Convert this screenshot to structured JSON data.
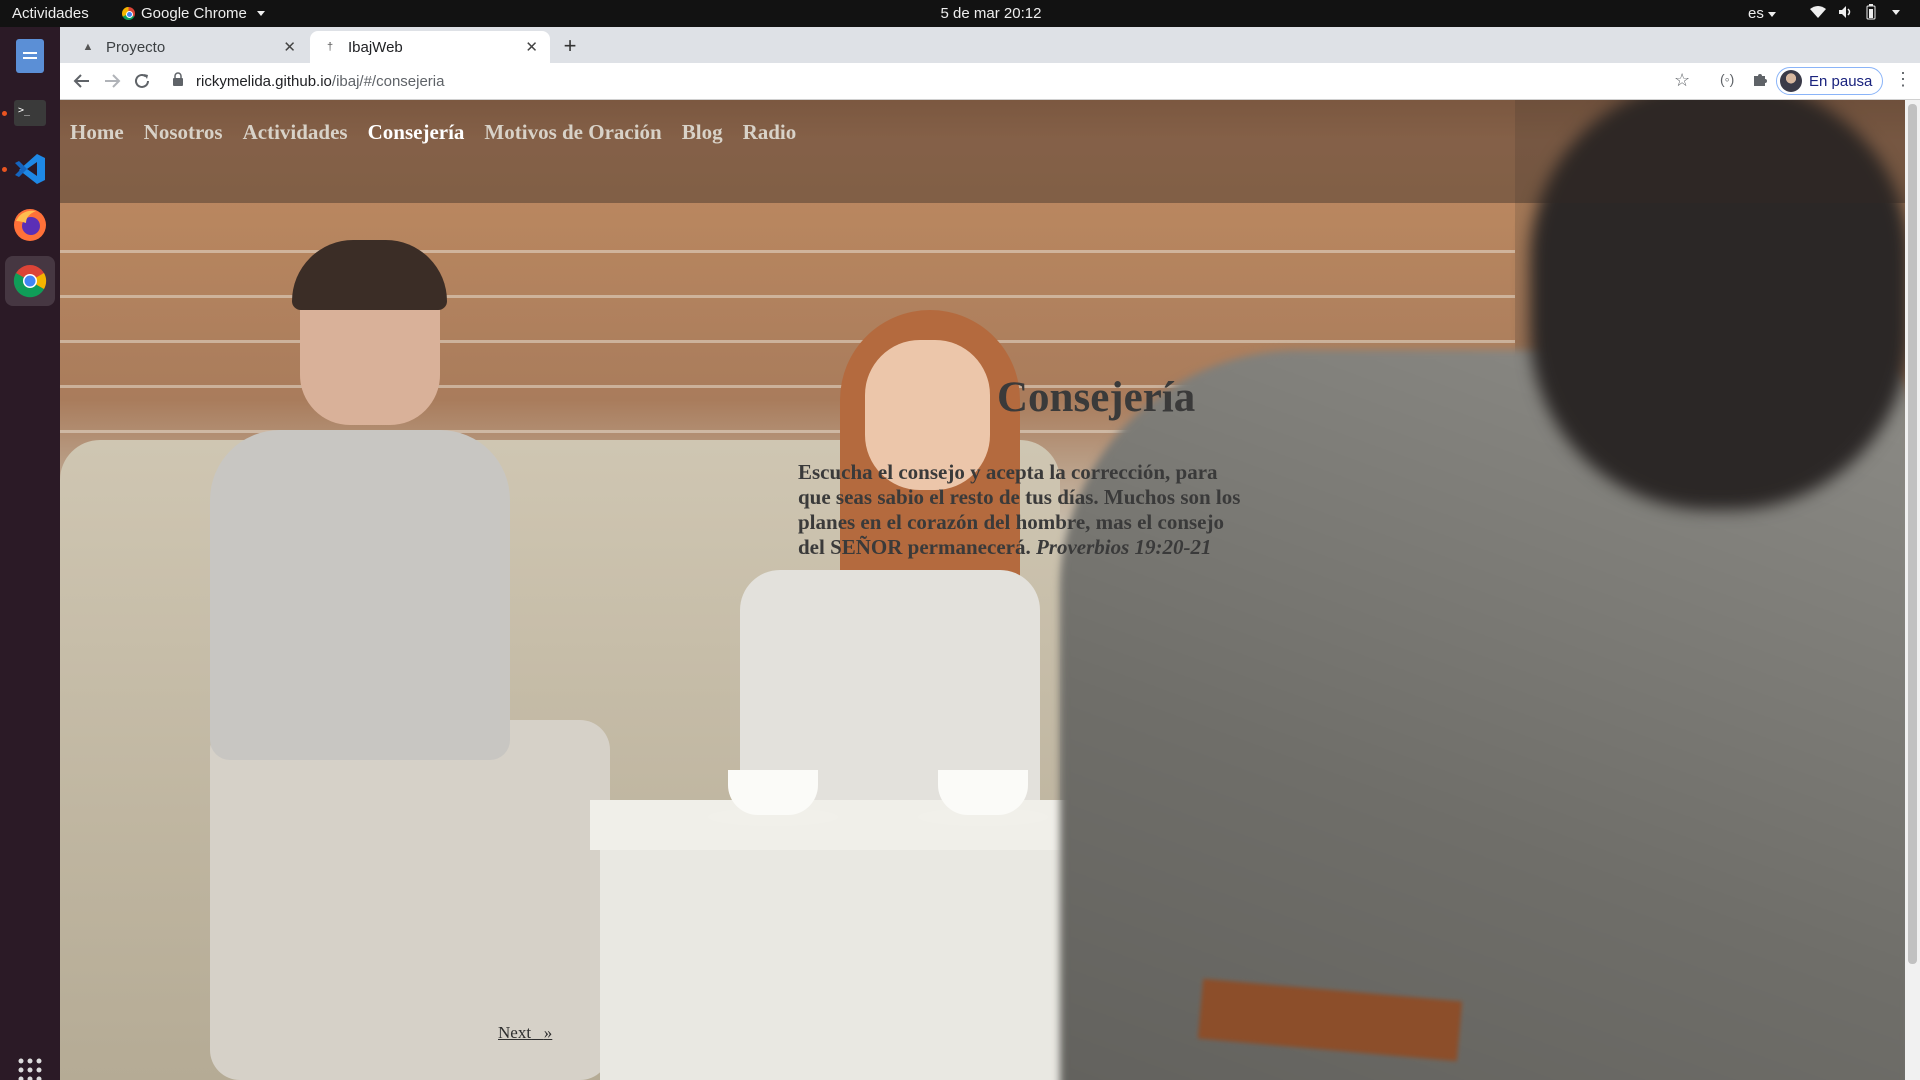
{
  "topbar": {
    "activities": "Actividades",
    "app_name": "Google Chrome",
    "clock": "5 de mar  20:12",
    "lang": "es"
  },
  "dock": {
    "items": [
      "files-icon",
      "terminal-icon",
      "vscode-icon",
      "firefox-icon",
      "chrome-icon",
      "show-apps-icon"
    ]
  },
  "browser": {
    "tabs": [
      {
        "title": "Proyecto",
        "active": false
      },
      {
        "title": "IbajWeb",
        "active": true
      }
    ],
    "url_host": "rickymelida.github.io",
    "url_path": "/ibaj/#/consejeria",
    "profile_label": "En pausa"
  },
  "site": {
    "nav": [
      "Home",
      "Nosotros",
      "Actividades",
      "Consejería",
      "Motivos de Oración",
      "Blog",
      "Radio"
    ],
    "current": "Consejería",
    "title": "Consejería",
    "body": "Escucha el consejo y acepta la corrección, para que seas sabio el resto de tus días. Muchos son los planes en el corazón del hombre, mas el consejo del SEÑOR permanecerá.",
    "reference": "Proverbios 19:20-21",
    "next_label": "Next",
    "next_arrow": "»"
  },
  "colors": {
    "topbar": "#121212",
    "dock": "#2b1a26",
    "accent": "#e95420"
  }
}
